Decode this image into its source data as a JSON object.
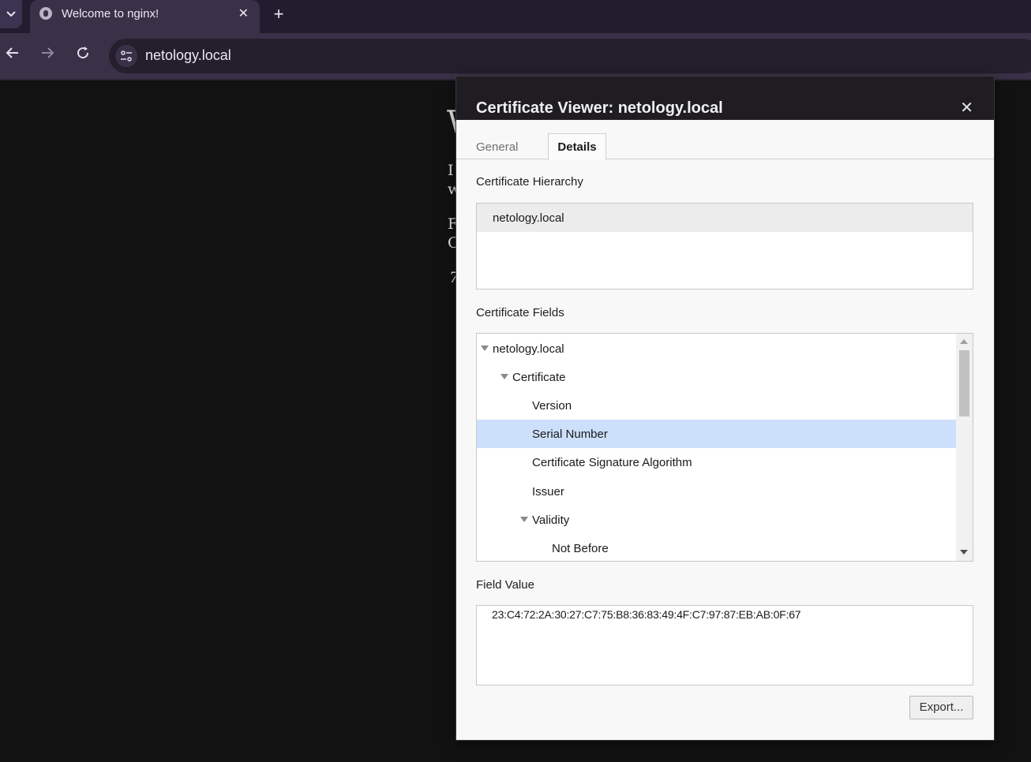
{
  "browser": {
    "tab_title": "Welcome to nginx!",
    "url": "netology.local"
  },
  "background_page": {
    "glyphs": [
      "W",
      "I",
      "w",
      "F",
      "C",
      "7"
    ]
  },
  "dialog": {
    "title": "Certificate Viewer: netology.local",
    "tabs": [
      {
        "label": "General",
        "active": false
      },
      {
        "label": "Details",
        "active": true
      }
    ],
    "hierarchy": {
      "label": "Certificate Hierarchy",
      "items": [
        "netology.local"
      ]
    },
    "fields": {
      "label": "Certificate Fields",
      "items": [
        {
          "label": "netology.local",
          "level": 0,
          "expanded": true,
          "selected": false
        },
        {
          "label": "Certificate",
          "level": 1,
          "expanded": true,
          "selected": false
        },
        {
          "label": "Version",
          "level": 2,
          "selected": false
        },
        {
          "label": "Serial Number",
          "level": 2,
          "selected": true
        },
        {
          "label": "Certificate Signature Algorithm",
          "level": 2,
          "selected": false
        },
        {
          "label": "Issuer",
          "level": 2,
          "selected": false
        },
        {
          "label": "Validity",
          "level": 2,
          "expanded": true,
          "selected": false
        },
        {
          "label": "Not Before",
          "level": 3,
          "selected": false
        }
      ]
    },
    "field_value": {
      "label": "Field Value",
      "value": "23:C4:72:2A:30:27:C7:75:B8:36:83:49:4F:C7:97:87:EB:AB:0F:67"
    },
    "export_label": "Export..."
  }
}
